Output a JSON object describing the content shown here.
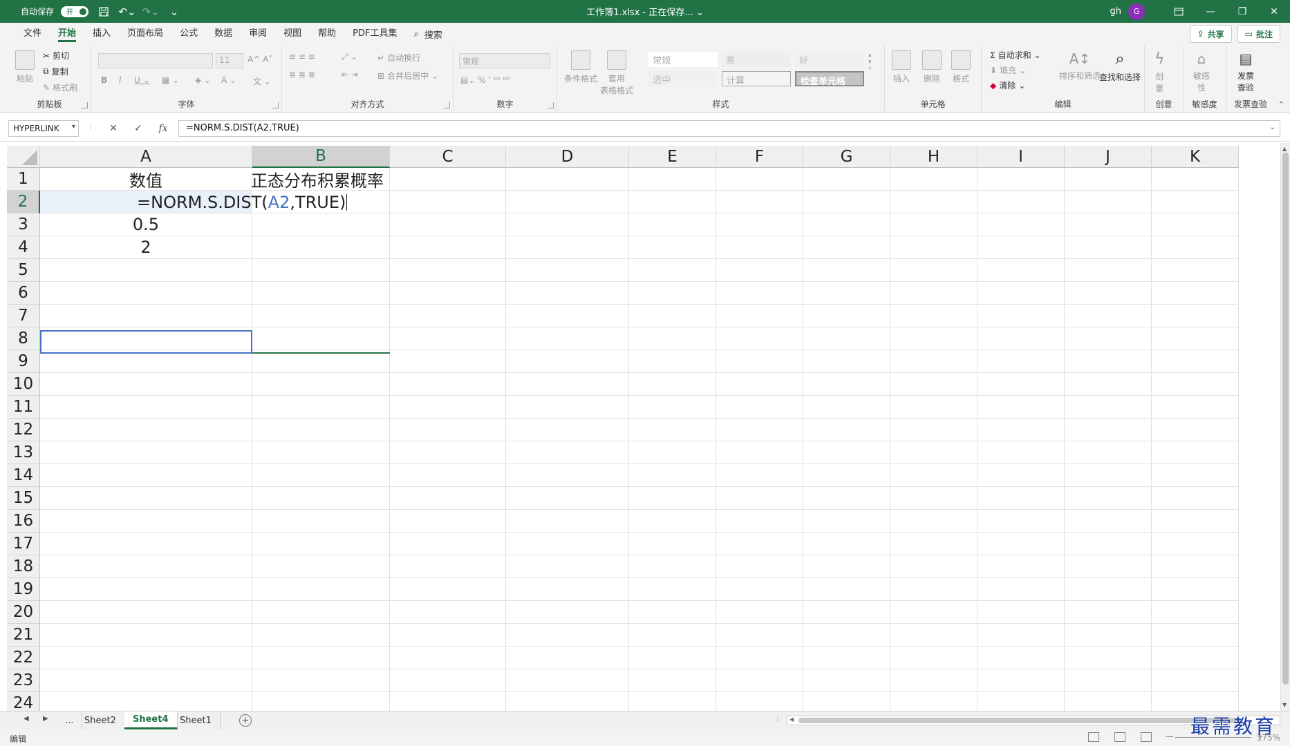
{
  "titlebar": {
    "autosave_label": "自动保存",
    "autosave_state": "开",
    "title": "工作簿1.xlsx - 正在保存... ⌄",
    "user": "gh",
    "avatar_letter": "G"
  },
  "tabs": [
    "文件",
    "开始",
    "插入",
    "页面布局",
    "公式",
    "数据",
    "审阅",
    "视图",
    "帮助",
    "PDF工具集"
  ],
  "active_tab": "开始",
  "search_label": "搜索",
  "share_label": "共享",
  "comment_label": "批注",
  "ribbon": {
    "clipboard": {
      "label": "剪贴板",
      "paste": "粘贴",
      "cut": "剪切",
      "copy": "复制",
      "format_painter": "格式刷"
    },
    "font": {
      "label": "字体",
      "size": "11"
    },
    "alignment": {
      "label": "对齐方式",
      "wrap": "自动换行",
      "merge": "合并后居中"
    },
    "number": {
      "label": "数字",
      "format": "常规"
    },
    "styles": {
      "label": "样式",
      "cond_format": "条件格式",
      "table_format": "套用\n表格格式",
      "cells": [
        "常规",
        "差",
        "好",
        "适中",
        "计算",
        "检查单元格"
      ]
    },
    "cells": {
      "label": "单元格",
      "insert": "插入",
      "delete": "删除",
      "format": "格式"
    },
    "editing": {
      "label": "编辑",
      "autosum": "自动求和",
      "fill": "填充",
      "clear": "清除",
      "sort": "排序和筛选",
      "find": "查找和选择"
    },
    "creative": {
      "label": "创意",
      "btn": "创\n意"
    },
    "sensitivity": {
      "label": "敏感度",
      "btn": "敏感\n性"
    },
    "invoice": {
      "label": "发票查验",
      "btn": "发票\n查验"
    }
  },
  "formula_bar": {
    "name_box": "HYPERLINK",
    "fx": "fx",
    "formula": "=NORM.S.DIST(A2,TRUE)"
  },
  "columns": [
    "A",
    "B",
    "C",
    "D",
    "E",
    "F",
    "G",
    "H",
    "I",
    "J",
    "K"
  ],
  "rows": [
    "1",
    "2",
    "3",
    "4",
    "5",
    "6",
    "7",
    "8",
    "9",
    "10",
    "11",
    "12",
    "13",
    "14",
    "15",
    "16",
    "17",
    "18",
    "19",
    "20",
    "21",
    "22",
    "23",
    "24"
  ],
  "cells": {
    "A1": "数值",
    "B1": "正态分布积累概率",
    "A2_prefix": "=NORM.S.DIST(",
    "A2_ref": "A2",
    "A2_suffix": ",TRUE)",
    "A3": "0.5",
    "A4": "2"
  },
  "sheets": [
    "...",
    "Sheet2",
    "Sheet4",
    "Sheet1"
  ],
  "active_sheet": "Sheet4",
  "status": {
    "mode": "编辑",
    "zoom": "175%"
  },
  "watermark": "最需教育"
}
